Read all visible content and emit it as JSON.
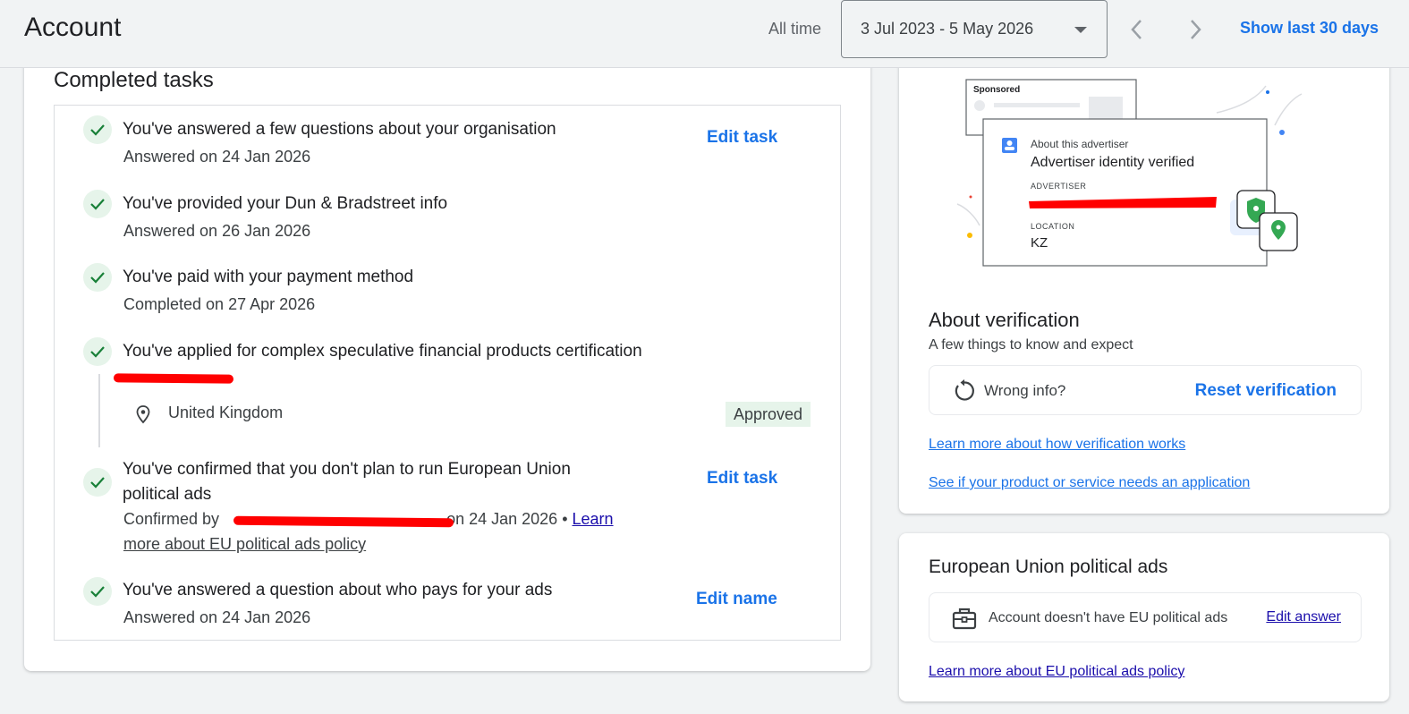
{
  "header": {
    "title": "Account",
    "all_time_label": "All time",
    "date_range": "3 Jul 2023 - 5 May 2026",
    "show_last_label": "Show last 30 days"
  },
  "completed": {
    "title": "Completed tasks",
    "tasks": [
      {
        "head": "You've answered a few questions about your organisation",
        "sub": "Answered on 24 Jan 2026",
        "action": "Edit task"
      },
      {
        "head": "You've provided your Dun & Bradstreet info",
        "sub": "Answered on 26 Jan 2026"
      },
      {
        "head": "You've paid with your payment method",
        "sub": "Completed on 27 Apr 2026"
      },
      {
        "head": "You've applied for complex speculative financial products certification",
        "location": "United Kingdom",
        "status": "Approved"
      },
      {
        "head_line1": "You've confirmed that you don't plan to run European Union",
        "head_line2": "political ads",
        "sub_prefix": "Confirmed by",
        "sub_suffix": "on 24 Jan 2026 •",
        "link_part1": "Learn",
        "link_part2": "more about EU political ads policy",
        "action": "Edit task"
      },
      {
        "head": "You've answered a question about who pays for your ads",
        "sub": "Answered on 24 Jan 2026",
        "action": "Edit name"
      }
    ]
  },
  "illustration": {
    "sponsored": "Sponsored",
    "about_advertiser": "About this advertiser",
    "identity_verified": "Advertiser identity verified",
    "advertiser_label": "ADVERTISER",
    "location_label": "LOCATION",
    "location_value": "KZ"
  },
  "verification": {
    "title": "About verification",
    "subtitle": "A few things to know and expect",
    "wrong_info": "Wrong info?",
    "reset": "Reset verification",
    "link1": "Learn more about how verification works",
    "link2": "See if your product or service needs an application"
  },
  "eu": {
    "title": "European Union political ads",
    "status": "Account doesn't have EU political ads",
    "edit": "Edit answer",
    "link": "Learn more about EU political ads policy"
  },
  "colors": {
    "accent": "#1a73e8",
    "check_bg": "#e6f4ea",
    "check": "#188038",
    "redaction": "#ff0000"
  }
}
